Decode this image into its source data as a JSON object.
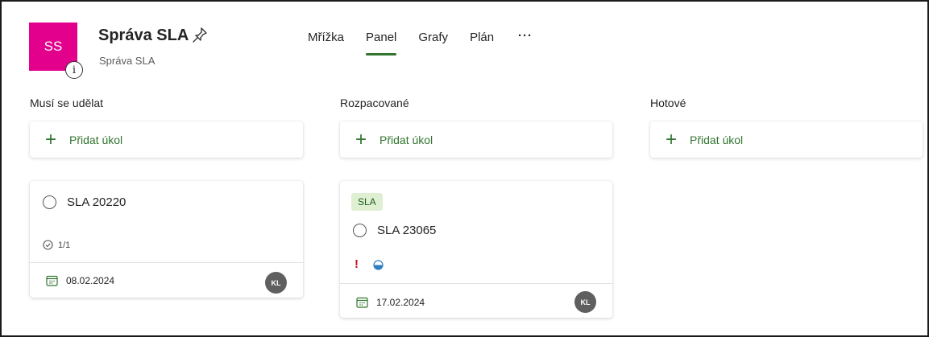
{
  "header": {
    "avatar_initials": "SS",
    "avatar_color": "#e3008c",
    "title": "Správa SLA",
    "subtitle": "Správa SLA",
    "info_glyph": "i",
    "pin_icon": "pin-icon"
  },
  "tabs": [
    {
      "label": "Mřížka",
      "active": false
    },
    {
      "label": "Panel",
      "active": true
    },
    {
      "label": "Grafy",
      "active": false
    },
    {
      "label": "Plán",
      "active": false
    }
  ],
  "more_label": "···",
  "accent_color": "#31752f",
  "columns": [
    {
      "title": "Musí se udělat",
      "add_label": "Přidat úkol",
      "cards": [
        {
          "name": "SLA 20220",
          "checklist": "1/1",
          "due": "08.02.2024",
          "assignee": "KL"
        }
      ]
    },
    {
      "title": "Rozpacované",
      "add_label": "Přidat úkol",
      "cards": [
        {
          "label_tag": "SLA",
          "label_color": "#dff0d2",
          "name": "SLA 23065",
          "priority": "!",
          "progress": "in-progress",
          "due": "17.02.2024",
          "assignee": "KL"
        }
      ]
    },
    {
      "title": "Hotové",
      "add_label": "Přidat úkol",
      "cards": []
    }
  ]
}
